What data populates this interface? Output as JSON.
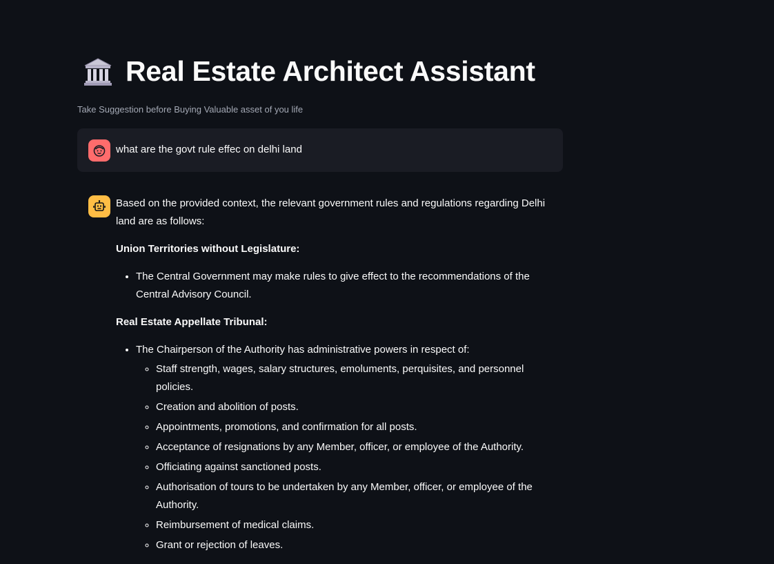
{
  "header": {
    "title": "Real Estate Architect Assistant",
    "title_icon": "classical-building-icon",
    "subtitle": "Take Suggestion before Buying Valuable asset of you life"
  },
  "chat": {
    "user_message": {
      "avatar_icon": "user-face-icon",
      "avatar_color": "#ff6c6c",
      "text": "what are the govt rule effec on delhi land"
    },
    "assistant_message": {
      "avatar_icon": "robot-icon",
      "avatar_color": "#ffbd45",
      "intro": "Based on the provided context, the relevant government rules and regulations regarding Delhi land are as follows:",
      "section1_heading": "Union Territories without Legislature:",
      "section1_items": [
        "The Central Government may make rules to give effect to the recommendations of the Central Advisory Council."
      ],
      "section2_heading": "Real Estate Appellate Tribunal:",
      "section2_item": "The Chairperson of the Authority has administrative powers in respect of:",
      "section2_subitems": [
        "Staff strength, wages, salary structures, emoluments, perquisites, and personnel policies.",
        "Creation and abolition of posts.",
        "Appointments, promotions, and confirmation for all posts.",
        "Acceptance of resignations by any Member, officer, or employee of the Authority.",
        "Officiating against sanctioned posts.",
        "Authorisation of tours to be undertaken by any Member, officer, or employee of the Authority.",
        "Reimbursement of medical claims.",
        "Grant or rejection of leaves."
      ]
    }
  },
  "colors": {
    "background": "#0e1117",
    "user_bubble": "#1a1c24",
    "text": "#fafafa",
    "subtitle": "#a3a8b4"
  }
}
